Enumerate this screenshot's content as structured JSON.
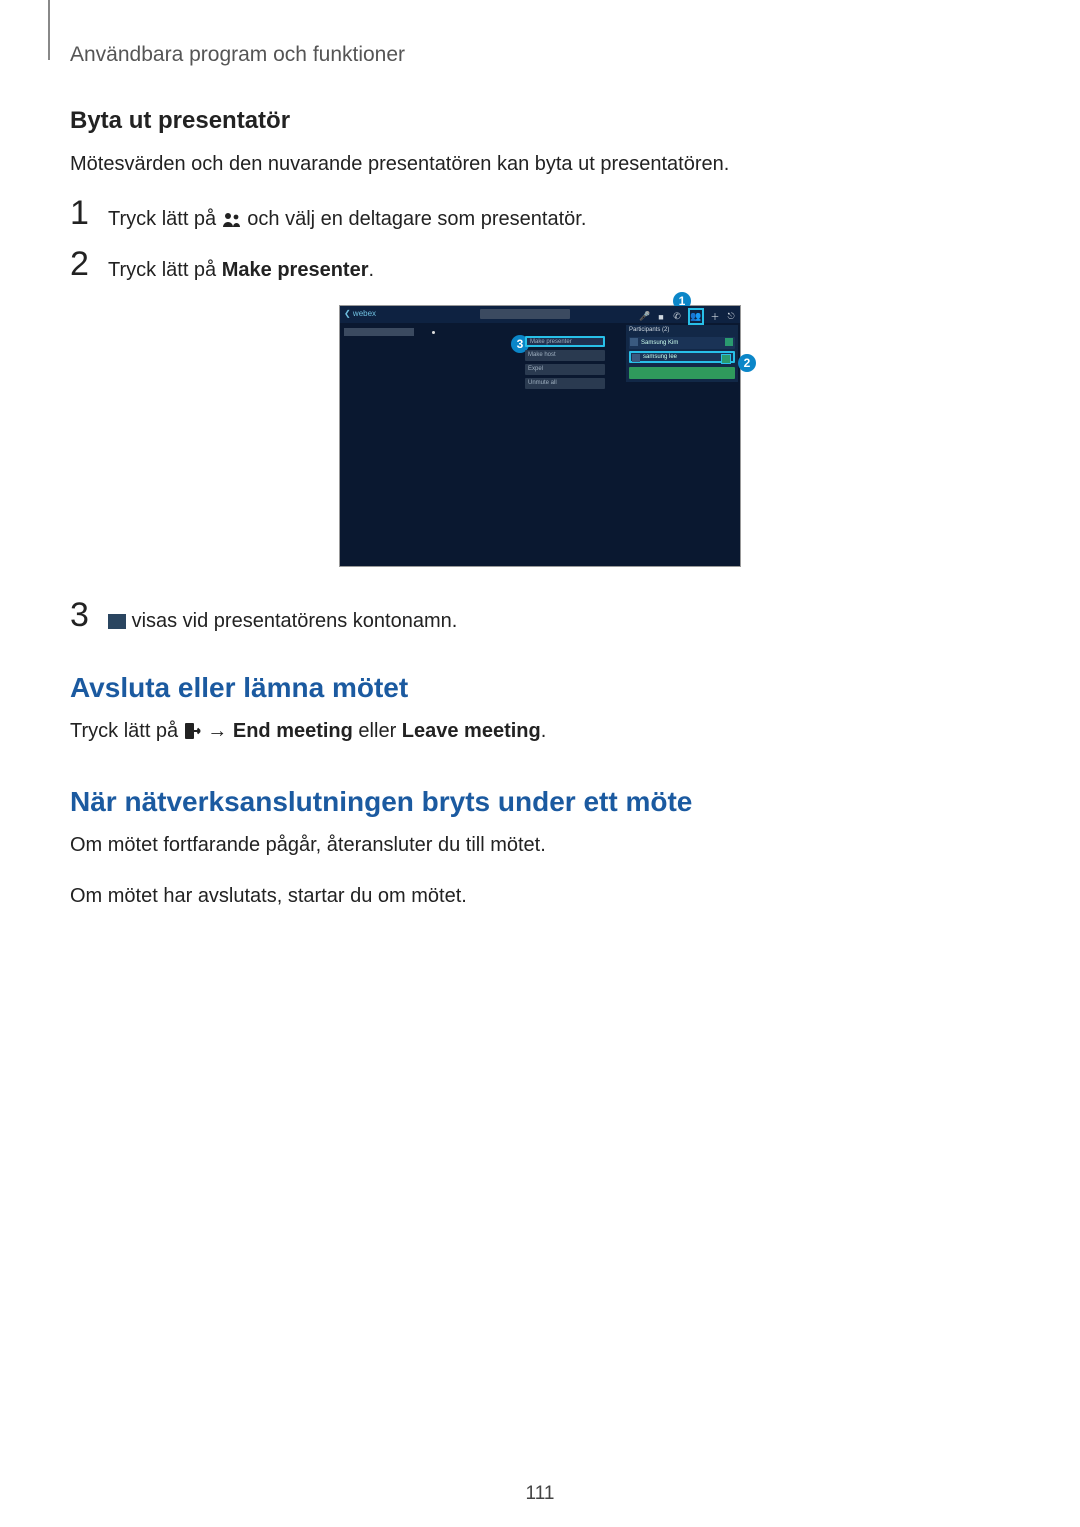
{
  "header": "Användbara program och funktioner",
  "section1": {
    "title": "Byta ut presentatör",
    "intro": "Mötesvärden och den nuvarande presentatören kan byta ut presentatören.",
    "step1_a": "Tryck lätt på ",
    "step1_b": " och välj en deltagare som presentatör.",
    "step2_a": "Tryck lätt på ",
    "step2_bold": "Make presenter",
    "step2_b": ".",
    "step3": " visas vid presentatörens kontonamn."
  },
  "screenshot": {
    "back": "❮ webex",
    "panel_header": "Participants (2)",
    "row1": "Samsung Kim",
    "row2": "samsung lee",
    "menu1": "Make presenter",
    "menu2": "Make host",
    "menu3": "Expel",
    "menu4": "Unmute all",
    "callout1": "1",
    "callout2": "2",
    "callout3": "3"
  },
  "section2": {
    "title": "Avsluta eller lämna mötet",
    "p_a": "Tryck lätt på ",
    "arrow": " → ",
    "bold1": "End meeting",
    "mid": " eller ",
    "bold2": "Leave meeting",
    "end": "."
  },
  "section3": {
    "title": "När nätverksanslutningen bryts under ett möte",
    "p1": "Om mötet fortfarande pågår, återansluter du till mötet.",
    "p2": "Om mötet har avslutats, startar du om mötet."
  },
  "pagenum": "111"
}
